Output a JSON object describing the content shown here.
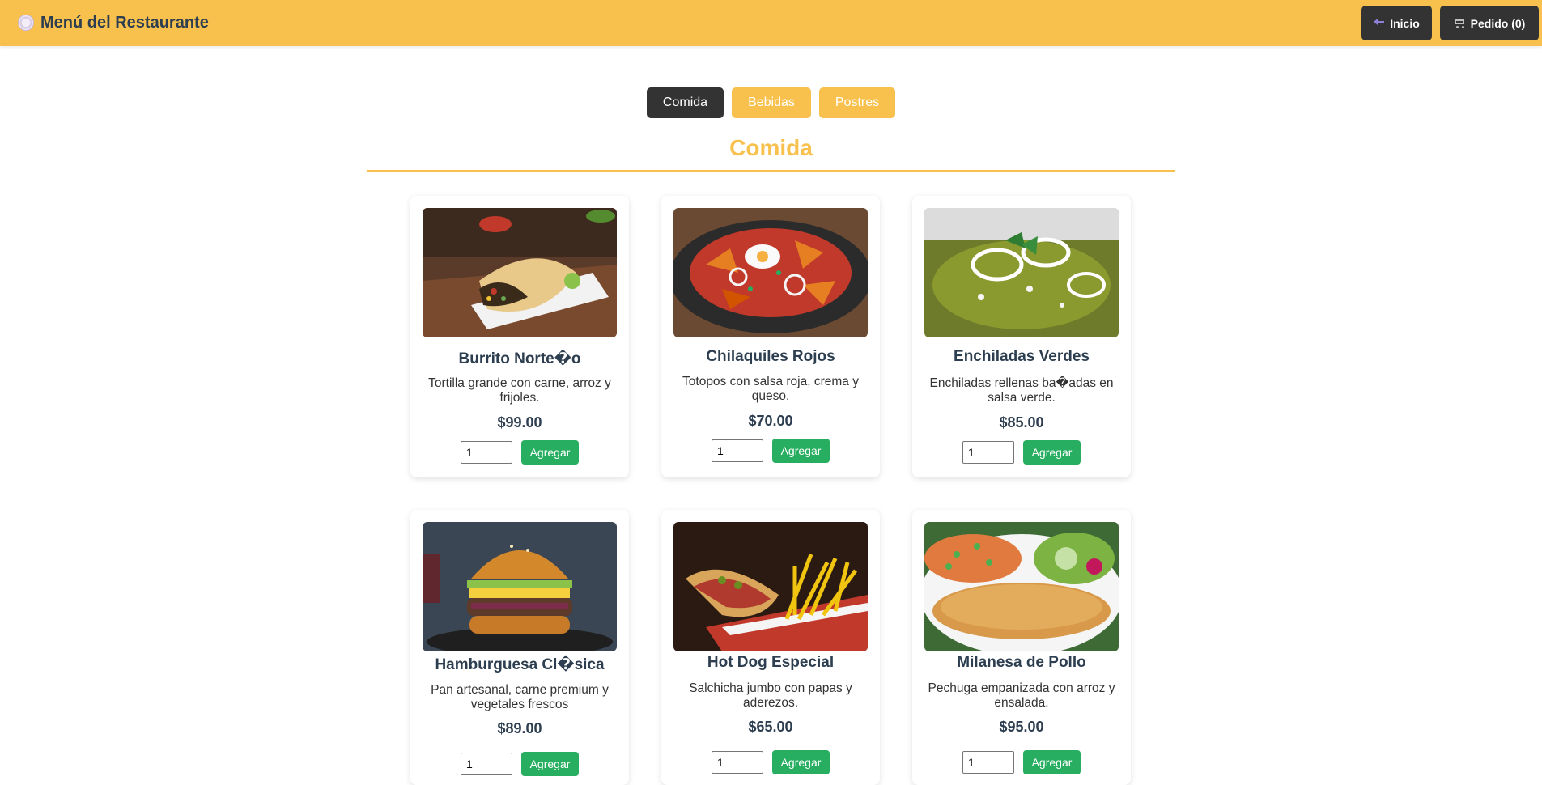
{
  "header": {
    "brand_icon": "plate-icon",
    "title": "Menú del Restaurante",
    "inicio_label": "Inicio",
    "pedido_label": "Pedido (0)"
  },
  "tabs": [
    {
      "label": "Comida",
      "active": true
    },
    {
      "label": "Bebidas",
      "active": false
    },
    {
      "label": "Postres",
      "active": false
    }
  ],
  "section": {
    "title": "Comida"
  },
  "items": [
    {
      "name": "Burrito Norte�o",
      "desc": "Tortilla grande con carne, arroz y frijoles.",
      "price": "$99.00",
      "qty": "1",
      "button": "Agregar"
    },
    {
      "name": "Chilaquiles Rojos",
      "desc": "Totopos con salsa roja, crema y queso.",
      "price": "$70.00",
      "qty": "1",
      "button": "Agregar"
    },
    {
      "name": "Enchiladas Verdes",
      "desc": "Enchiladas rellenas ba�adas en salsa verde.",
      "price": "$85.00",
      "qty": "1",
      "button": "Agregar"
    },
    {
      "name": "Hamburguesa Cl�sica",
      "desc": "Pan artesanal, carne premium y vegetales frescos",
      "price": "$89.00",
      "qty": "1",
      "button": "Agregar"
    },
    {
      "name": "Hot Dog Especial",
      "desc": "Salchicha jumbo con papas y aderezos.",
      "price": "$65.00",
      "qty": "1",
      "button": "Agregar"
    },
    {
      "name": "Milanesa de Pollo",
      "desc": "Pechuga empanizada con arroz y ensalada.",
      "price": "$95.00",
      "qty": "1",
      "button": "Agregar"
    }
  ],
  "colors": {
    "accent": "#f8c04c",
    "dark": "#333333",
    "green": "#27ae60",
    "text": "#2c3e50"
  }
}
